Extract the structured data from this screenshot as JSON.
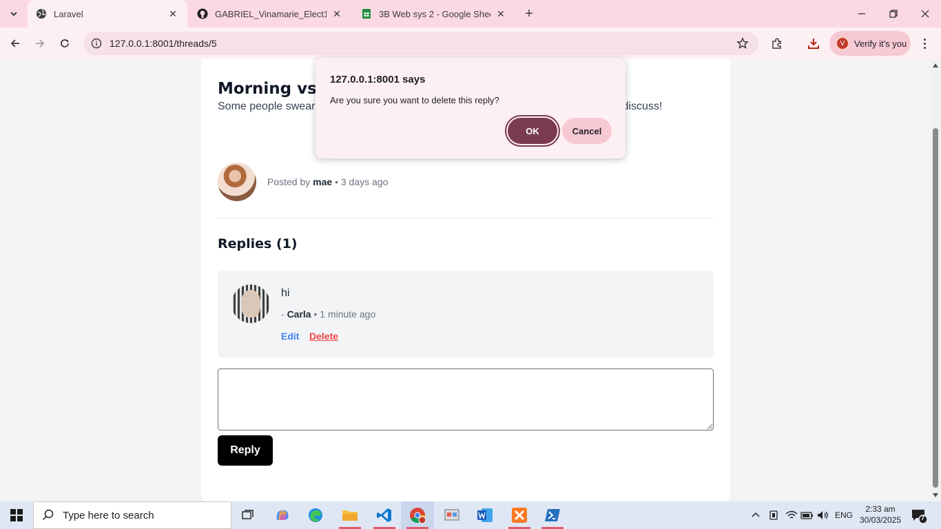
{
  "browser": {
    "tabs": [
      {
        "title": "Laravel",
        "active": true,
        "icon": "globe-icon"
      },
      {
        "title": "GABRIEL_Vinamarie_Elect1/gab",
        "active": false,
        "icon": "github-icon"
      },
      {
        "title": "3B Web sys 2 - Google Sheets",
        "active": false,
        "icon": "sheets-icon"
      }
    ],
    "url": "127.0.0.1:8001/threads/5",
    "profile_label": "Verify it's you",
    "profile_initial": "V"
  },
  "thread": {
    "title": "Morning vs. N",
    "body": "Some people swear                                                                                  ght when the world is quiet. Are yo                                                                                   productive, and why? Let’s discuss!",
    "posted_prefix": "Posted by",
    "author": "mae",
    "separator": "•",
    "posted_time": "3 days ago"
  },
  "replies": {
    "heading": "Replies (1)",
    "items": [
      {
        "text": "hi",
        "prefix": "-",
        "author": "Carla",
        "separator": "•",
        "time": "1 minute ago",
        "edit_label": "Edit",
        "delete_label": "Delete"
      }
    ]
  },
  "composer": {
    "placeholder": "",
    "submit_label": "Reply"
  },
  "dialog": {
    "title": "127.0.0.1:8001 says",
    "message": "Are you sure you want to delete this reply?",
    "ok_label": "OK",
    "cancel_label": "Cancel"
  },
  "taskbar": {
    "search_placeholder": "Type here to search",
    "language": "ENG",
    "time": "2:33 am",
    "date": "30/03/2025",
    "notification_count": "7"
  },
  "colors": {
    "tabstrip": "#fbd9e2",
    "toolbar": "#fdf0f3",
    "ok_button": "#7a3a4f",
    "cancel_button": "#f7c9d5",
    "reply_button": "#000000",
    "delete_link": "#ef4444",
    "edit_link": "#3b82f6"
  }
}
